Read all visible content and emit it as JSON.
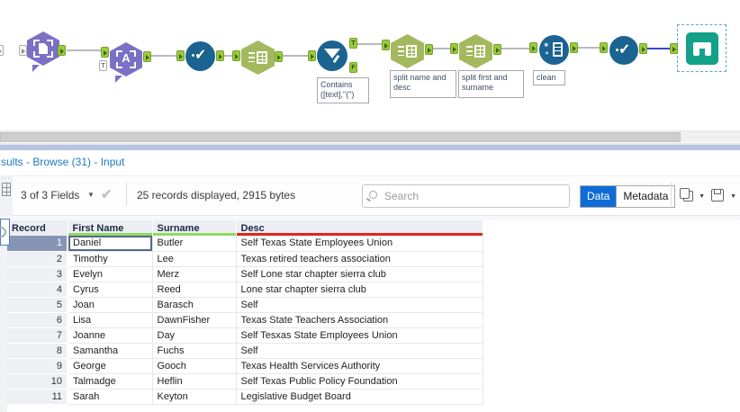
{
  "colors": {
    "tool_purple": "#7a70c5",
    "tool_green": "#a4b95f",
    "tool_blue": "#1b6390",
    "tool_teal": "#13a18a",
    "anchor_green": "#9ccb3b",
    "selected_wire_blue": "#3b44d8",
    "selection_dashed_blue": "#54a7e8",
    "accent_button_blue": "#0f6cd6",
    "link_blue": "#1f78c1",
    "underline_green": "#8edc62",
    "underline_red": "#e1251b",
    "selected_record_bg": "#8795b5"
  },
  "workflow": {
    "letter_a": "A",
    "filter_true": "T",
    "filter_false": "F",
    "template_anchor": "T",
    "annotations": {
      "filter": "Contains\n([text],\"(\")",
      "split1": "split name and desc",
      "split2": "split first and surname",
      "clean": "clean"
    }
  },
  "results": {
    "panel_title": "sults - Browse (31) - Input",
    "toolbar": {
      "fields_summary": "3 of 3 Fields",
      "records_summary": "25 records displayed, 2915 bytes",
      "search_placeholder": "Search",
      "data_label": "Data",
      "metadata_label": "Metadata"
    },
    "table": {
      "headers": [
        "Record",
        "First Name",
        "Surname",
        "Desc"
      ],
      "rows": [
        {
          "record": "1",
          "first_name": "Daniel",
          "surname": "Butler",
          "desc": "Self Texas State Employees Union"
        },
        {
          "record": "2",
          "first_name": "Timothy",
          "surname": "Lee",
          "desc": "Texas retired teachers association"
        },
        {
          "record": "3",
          "first_name": "Evelyn",
          "surname": "Merz",
          "desc": "Self Lone star chapter sierra club"
        },
        {
          "record": "4",
          "first_name": "Cyrus",
          "surname": "Reed",
          "desc": "Lone star chapter sierra club"
        },
        {
          "record": "5",
          "first_name": "Joan",
          "surname": "Barasch",
          "desc": "Self"
        },
        {
          "record": "6",
          "first_name": "Lisa",
          "surname": "DawnFisher",
          "desc": "Texas State Teachers Association"
        },
        {
          "record": "7",
          "first_name": "Joanne",
          "surname": "Day",
          "desc": "Self Tesxas State Employees Union"
        },
        {
          "record": "8",
          "first_name": "Samantha",
          "surname": "Fuchs",
          "desc": "Self"
        },
        {
          "record": "9",
          "first_name": "George",
          "surname": "Gooch",
          "desc": "Texas Health Services Authority"
        },
        {
          "record": "10",
          "first_name": "Talmadge",
          "surname": "Heflin",
          "desc": "Self Texas Public Policy Foundation"
        },
        {
          "record": "11",
          "first_name": "Sarah",
          "surname": "Keyton",
          "desc": "Legislative Budget Board"
        }
      ]
    }
  }
}
